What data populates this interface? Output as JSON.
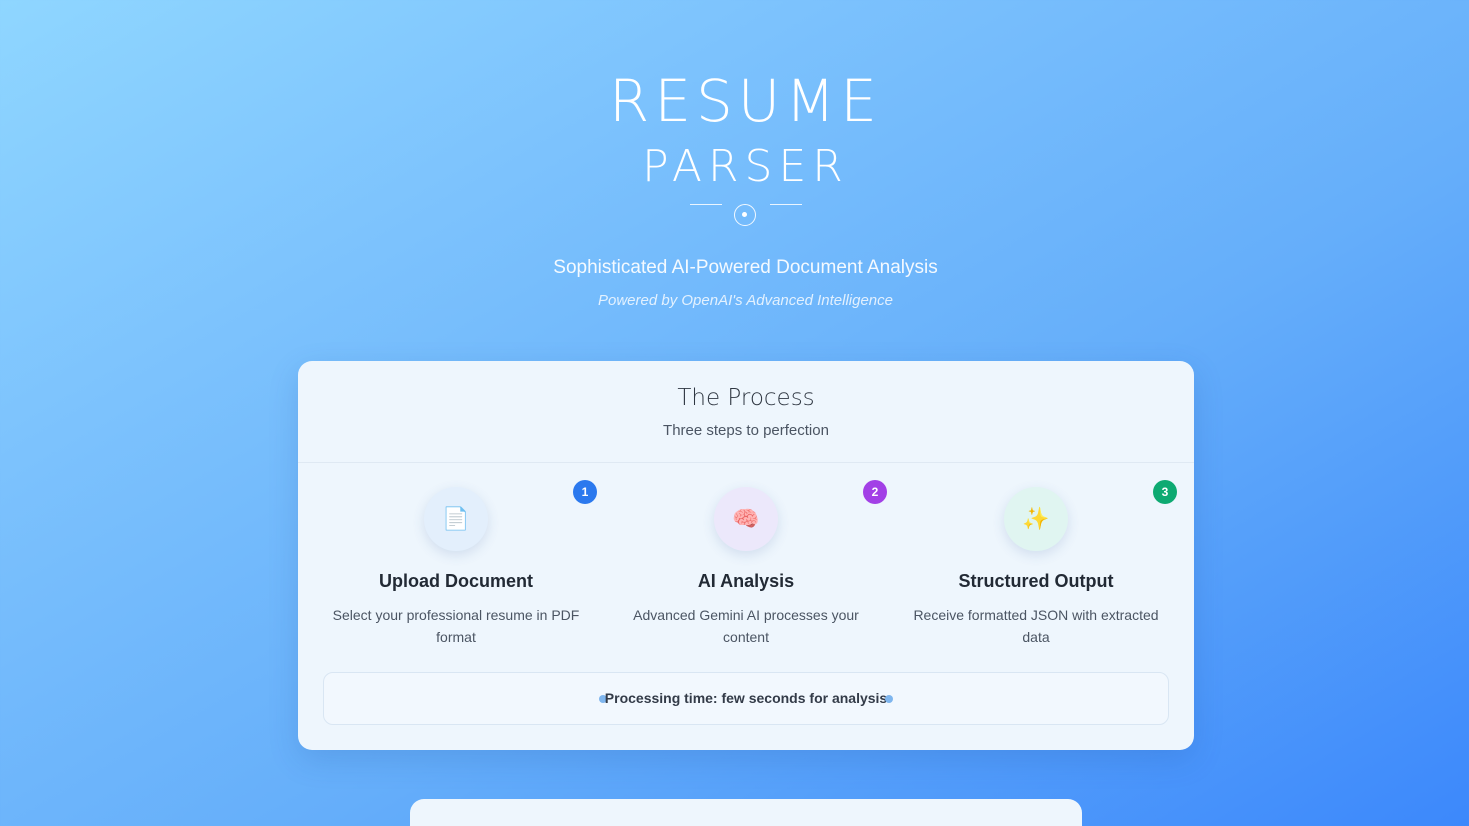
{
  "hero": {
    "title_line_1": "RESUME",
    "title_line_2": "PARSER",
    "subtitle": "Sophisticated AI-Powered Document Analysis",
    "powered_by": "Powered by OpenAI's Advanced Intelligence"
  },
  "process": {
    "title": "The Process",
    "subtitle": "Three steps to perfection",
    "steps": [
      {
        "number": "1",
        "icon": "📄",
        "icon_name": "document-icon",
        "title": "Upload Document",
        "description": "Select your professional resume in PDF format",
        "badge_color": "#2b79ee"
      },
      {
        "number": "2",
        "icon": "🧠",
        "icon_name": "brain-icon",
        "title": "AI Analysis",
        "description": "Advanced Gemini AI processes your content",
        "badge_color": "#a240e6"
      },
      {
        "number": "3",
        "icon": "✨",
        "icon_name": "sparkles-icon",
        "title": "Structured Output",
        "description": "Receive formatted JSON with extracted data",
        "badge_color": "#0eaa72"
      }
    ],
    "processing_time": "Processing time: few seconds for analysis"
  },
  "colors": {
    "background_start": "#8fd6ff",
    "background_end": "#3c88fb",
    "card_background": "#eef6fd"
  }
}
